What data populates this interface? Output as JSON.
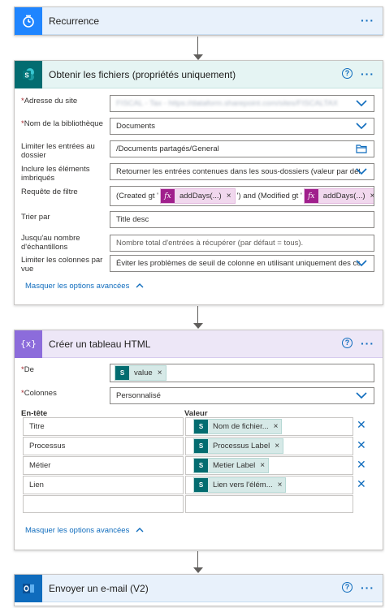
{
  "recurrence": {
    "title": "Recurrence",
    "more": "···"
  },
  "get_files": {
    "title": "Obtenir les fichiers (propriétés uniquement)",
    "help": "?",
    "more": "···",
    "fields": {
      "site_label": "Adresse du site",
      "site_value": "FISCAL - Tax - https://dataform.sharepoint.com/sites/FISCALTAX",
      "library_label": "Nom de la bibliothèque",
      "library_value": "Documents",
      "limit_folder_label": "Limiter les entrées au dossier",
      "limit_folder_value": "/Documents partagés/General",
      "nested_label": "Inclure les éléments imbriqués",
      "nested_value": "Retourner les entrées contenues dans les sous-dossiers (valeur par défaut",
      "filter_label": "Requête de filtre",
      "filter_part1": "(Created gt '",
      "filter_token1": "addDays(...)",
      "filter_part2": "') and (Modified gt '",
      "filter_token2": "addDays(...)",
      "filter_part3": "')",
      "sort_label": "Trier par",
      "sort_value": "Title desc",
      "top_label": "Jusqu'au nombre d'échantillons",
      "top_placeholder": "Nombre total d'entrées à récupérer (par défaut = tous).",
      "limit_cols_label": "Limiter les colonnes par vue",
      "limit_cols_value": "Éviter les problèmes de seuil de colonne en utilisant uniquement des colo"
    },
    "adv_link": "Masquer les options avancées"
  },
  "html_table": {
    "title": "Créer un tableau HTML",
    "help": "?",
    "more": "···",
    "from_label": "De",
    "from_token": "value",
    "columns_label": "Colonnes",
    "columns_value": "Personnalisé",
    "header_col": "En-tête",
    "value_col": "Valeur",
    "rows": [
      {
        "header": "Titre",
        "value": "Nom de fichier..."
      },
      {
        "header": "Processus",
        "value": "Processus Label"
      },
      {
        "header": "Métier",
        "value": "Metier Label"
      },
      {
        "header": "Lien",
        "value": "Lien vers l'élém..."
      }
    ],
    "adv_link": "Masquer les options avancées"
  },
  "send_email": {
    "title": "Envoyer un e-mail (V2)",
    "help": "?",
    "more": "···"
  },
  "colors": {
    "accent": "#0f6cbd",
    "sharepoint": "#036c70",
    "expression": "#a01f8c",
    "required": "#a4262c"
  }
}
